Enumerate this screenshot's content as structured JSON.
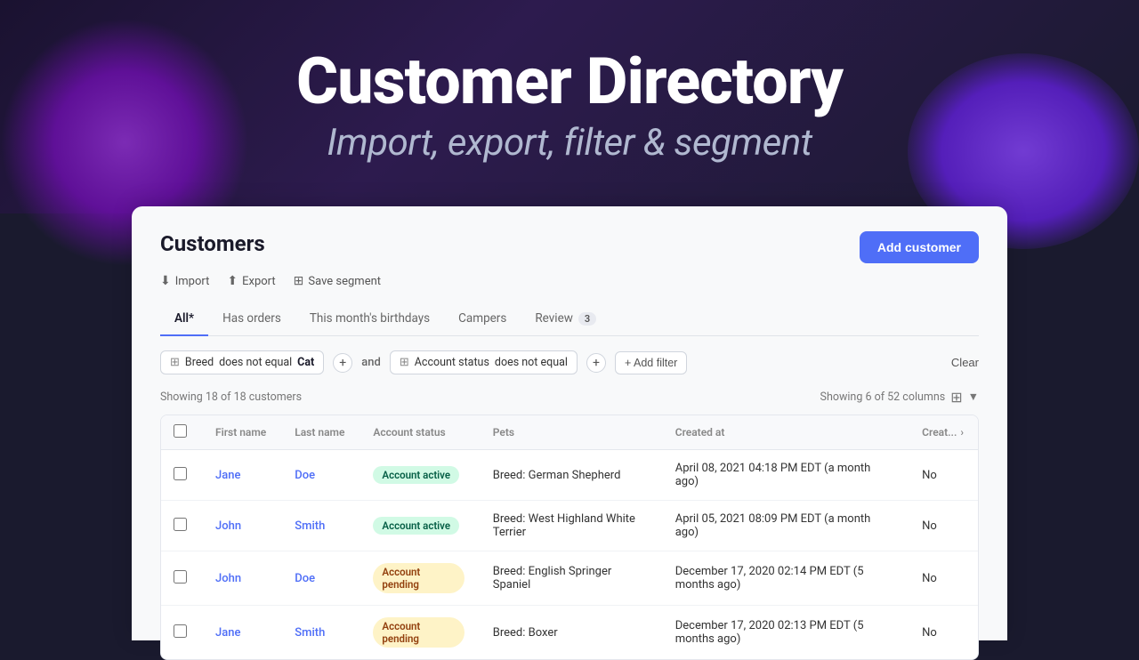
{
  "hero": {
    "title": "Customer Directory",
    "subtitle": "Import, export, filter & segment"
  },
  "page": {
    "title": "Customers",
    "add_customer_label": "Add customer"
  },
  "action_links": [
    {
      "id": "import",
      "label": "Import",
      "icon": "⬇"
    },
    {
      "id": "export",
      "label": "Export",
      "icon": "⬆"
    },
    {
      "id": "save-segment",
      "label": "Save segment",
      "icon": "⊞"
    }
  ],
  "tabs": [
    {
      "id": "all",
      "label": "All*",
      "active": true,
      "badge": null
    },
    {
      "id": "has-orders",
      "label": "Has orders",
      "active": false,
      "badge": null
    },
    {
      "id": "birthdays",
      "label": "This month's birthdays",
      "active": false,
      "badge": null
    },
    {
      "id": "campers",
      "label": "Campers",
      "active": false,
      "badge": null
    },
    {
      "id": "review",
      "label": "Review",
      "active": false,
      "badge": "3"
    }
  ],
  "filters": {
    "filter1": {
      "icon": "⊞",
      "field": "Breed",
      "operator": "does not equal",
      "value": "Cat"
    },
    "and_label": "and",
    "filter2": {
      "icon": "⊞",
      "field": "Account status",
      "operator": "does not equal",
      "value": ""
    },
    "add_filter_label": "+ Add filter",
    "clear_label": "Clear"
  },
  "table": {
    "showing_text": "Showing 18 of 18 customers",
    "columns_text": "Showing 6 of 52 columns",
    "columns": [
      {
        "id": "first_name",
        "label": "First name"
      },
      {
        "id": "last_name",
        "label": "Last name"
      },
      {
        "id": "account_status",
        "label": "Account status"
      },
      {
        "id": "pets",
        "label": "Pets"
      },
      {
        "id": "created_at",
        "label": "Created at"
      },
      {
        "id": "creat_extra",
        "label": "Creat..."
      }
    ],
    "rows": [
      {
        "id": 1,
        "first_name": "Jane",
        "last_name": "Doe",
        "account_status": "Account active",
        "status_type": "active",
        "pets": "Breed: German Shepherd",
        "created_at": "April 08, 2021 04:18 PM EDT (a month ago)",
        "extra": "No"
      },
      {
        "id": 2,
        "first_name": "John",
        "last_name": "Smith",
        "account_status": "Account active",
        "status_type": "active",
        "pets": "Breed: West Highland White Terrier",
        "created_at": "April 05, 2021 08:09 PM EDT (a month ago)",
        "extra": "No"
      },
      {
        "id": 3,
        "first_name": "John",
        "last_name": "Doe",
        "account_status": "Account pending",
        "status_type": "pending",
        "pets": "Breed: English Springer Spaniel",
        "created_at": "December 17, 2020 02:14 PM EDT (5 months ago)",
        "extra": "No"
      },
      {
        "id": 4,
        "first_name": "Jane",
        "last_name": "Smith",
        "account_status": "Account pending",
        "status_type": "pending",
        "pets": "Breed: Boxer",
        "created_at": "December 17, 2020 02:13 PM EDT (5 months ago)",
        "extra": "No"
      }
    ]
  }
}
